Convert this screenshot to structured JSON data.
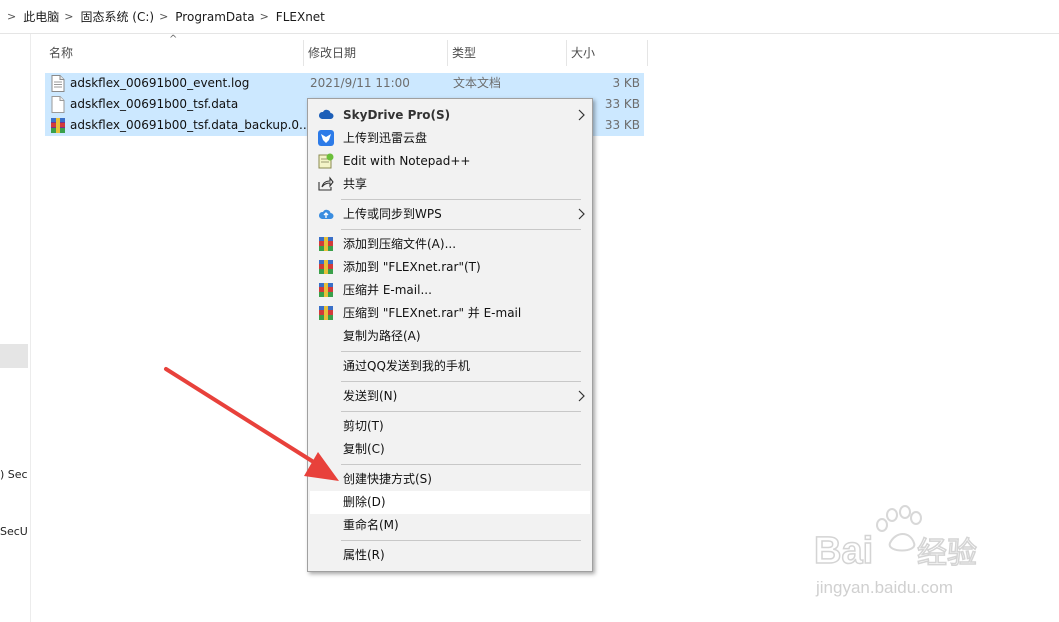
{
  "breadcrumb": [
    {
      "sep": ">",
      "label": "此电脑"
    },
    {
      "sep": ">",
      "label": "固态系统 (C:)"
    },
    {
      "sep": ">",
      "label": "ProgramData"
    },
    {
      "sep": ">",
      "label": "FLEXnet"
    }
  ],
  "leftpane": {
    "item1": ") Sec",
    "item2": "SecU"
  },
  "columns": {
    "name": "名称",
    "date": "修改日期",
    "type": "类型",
    "size": "大小",
    "sort_indicator": "^"
  },
  "files": [
    {
      "icon": "text-file-icon",
      "name": "adskflex_00691b00_event.log",
      "date": "2021/9/11 11:00",
      "type": "文本文档",
      "size": "3 KB"
    },
    {
      "icon": "blank-file-icon",
      "name": "adskflex_00691b00_tsf.data",
      "date": "",
      "type": "",
      "size": "33 KB"
    },
    {
      "icon": "winrar-archive-icon",
      "name": "adskflex_00691b00_tsf.data_backup.0...",
      "date": "",
      "type": "",
      "size": "33 KB"
    }
  ],
  "context_menu": {
    "items": [
      {
        "label": "SkyDrive Pro(S)",
        "icon": "cloud-icon",
        "submenu": true
      },
      {
        "label": "上传到迅雷云盘",
        "icon": "thunder-bird-icon"
      },
      {
        "label": "Edit with Notepad++",
        "icon": "notepad-plus-icon"
      },
      {
        "label": "共享",
        "icon": "share-icon"
      },
      {
        "label": "上传或同步到WPS",
        "icon": "wps-cloud-upload-icon",
        "submenu": true
      },
      {
        "label": "添加到压缩文件(A)...",
        "icon": "winrar-icon"
      },
      {
        "label": "添加到 \"FLEXnet.rar\"(T)",
        "icon": "winrar-icon"
      },
      {
        "label": "压缩并 E-mail...",
        "icon": "winrar-icon"
      },
      {
        "label": "压缩到 \"FLEXnet.rar\" 并 E-mail",
        "icon": "winrar-icon"
      },
      {
        "label": "复制为路径(A)",
        "icon": ""
      },
      {
        "label": "通过QQ发送到我的手机",
        "icon": ""
      },
      {
        "label": "发送到(N)",
        "icon": "",
        "submenu": true
      },
      {
        "label": "剪切(T)",
        "icon": ""
      },
      {
        "label": "复制(C)",
        "icon": ""
      },
      {
        "label": "创建快捷方式(S)",
        "icon": ""
      },
      {
        "label": "删除(D)",
        "icon": "",
        "highlighted": true
      },
      {
        "label": "重命名(M)",
        "icon": ""
      },
      {
        "label": "属性(R)",
        "icon": ""
      }
    ]
  },
  "annotation": {
    "arrow_color": "#e8413b"
  },
  "watermark": {
    "brand": "Bai du 经验",
    "url": "jingyan.baidu.com"
  },
  "colors": {
    "selection": "#cce8ff",
    "menu_bg": "#f2f2f2",
    "menu_hover": "#ffffff"
  }
}
